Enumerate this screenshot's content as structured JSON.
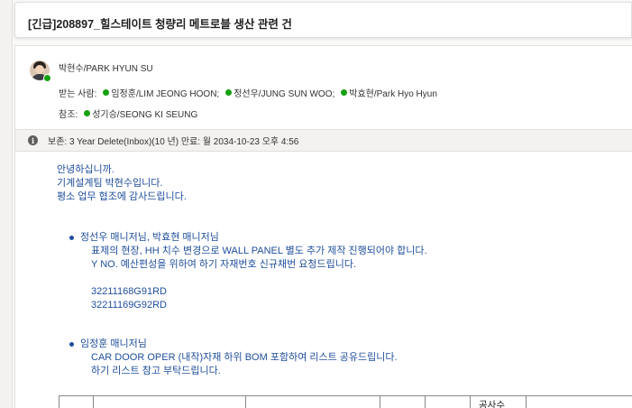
{
  "subject": "[긴급]208897_힐스테이트 청량리 메트로블 생산 관련 건",
  "sender": "박현수/PARK HYUN SU",
  "to": {
    "label": "받는 사람:",
    "recipients": [
      "임정훈/LIM JEONG HOON;",
      "정선우/JUNG SUN WOO;",
      "박효현/Park Hyo Hyun"
    ]
  },
  "cc": {
    "label": "참조:",
    "recipients": [
      "성기승/SEONG KI SEUNG"
    ]
  },
  "retention": "보존: 3 Year Delete(Inbox)(10 년) 만료: 월 2034-10-23 오후 4:56",
  "body": {
    "greeting": [
      "안녕하십니까.",
      "기계설계팀 박현수입니다.",
      "평소 업무 협조에 감사드립니다."
    ],
    "bullet1": {
      "head": "정선우 매니저님, 박효현 매니저님",
      "lines": [
        "표제의 현장, HH 치수 변경으로 WALL PANEL 별도 추가 제작 진행되어야 합니다.",
        "Y NO. 예산편성을 위하여 하기 자재번호 신규채번 요청드립니다."
      ],
      "codes": [
        "32211168G91RD",
        "32211169G92RD"
      ]
    },
    "bullet2": {
      "head": "임정훈 매니저님",
      "lines": [
        "CAR DOOR OPER (내작)자재 하위 BOM 포함하여 리스트 공유드립니다.",
        "하기 리스트 참고 부탁드립니다."
      ]
    },
    "table_header": "공사수"
  },
  "colors": {
    "presence": "#13a10e",
    "body_text": "#1f4e9c"
  },
  "icons": {
    "info": "info-icon",
    "presence": "presence-available-icon"
  }
}
